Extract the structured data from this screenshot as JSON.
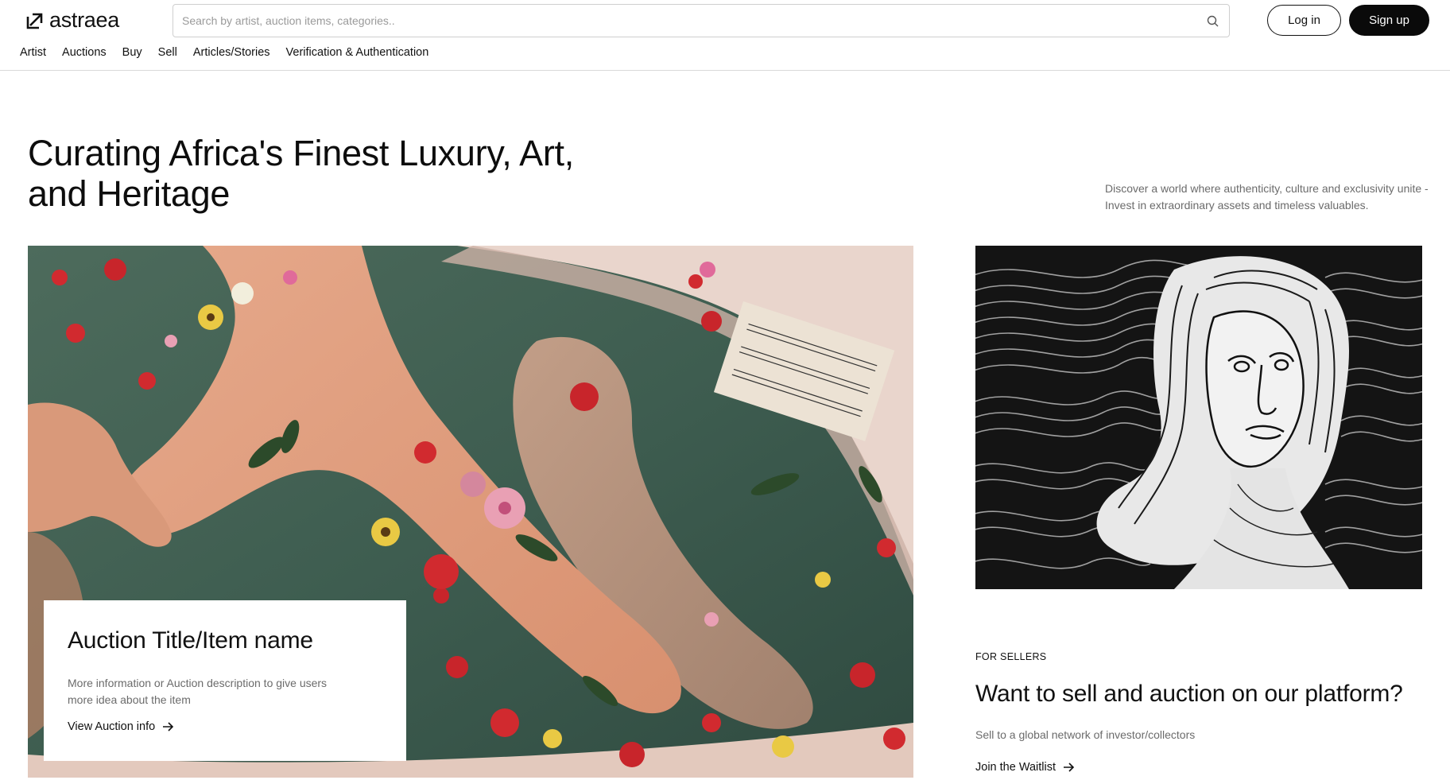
{
  "brand": {
    "name": "astraea",
    "logo_icon": "arrow-up-right-square-icon"
  },
  "search": {
    "placeholder": "Search by artist, auction items, categories..",
    "icon": "search-icon"
  },
  "auth": {
    "login_label": "Log in",
    "signup_label": "Sign up"
  },
  "nav": {
    "items": [
      {
        "label": "Artist"
      },
      {
        "label": "Auctions"
      },
      {
        "label": "Buy"
      },
      {
        "label": "Sell"
      },
      {
        "label": "Articles/Stories"
      },
      {
        "label": "Verification & Authentication"
      }
    ]
  },
  "hero": {
    "title": "Curating Africa's Finest Luxury, Art, and Heritage",
    "description": "Discover a world where authenticity, culture and exclusivity unite - Invest in extraordinary assets and timeless valuables."
  },
  "featured_auction": {
    "title": "Auction Title/Item name",
    "description": "More information or Auction description to give users more idea about the item",
    "link_label": "View Auction info",
    "link_icon": "arrow-right-icon"
  },
  "sellers": {
    "eyebrow": "FOR SELLERS",
    "title": "Want to sell and auction on our platform?",
    "description": "Sell to a global network of investor/collectors",
    "link_label": "Join the Waitlist",
    "link_icon": "arrow-right-icon"
  },
  "colors": {
    "primary": "#0a0a0a",
    "muted_text": "#6b6b6b",
    "border": "#d9d9d9",
    "water": "#3f5e51"
  }
}
